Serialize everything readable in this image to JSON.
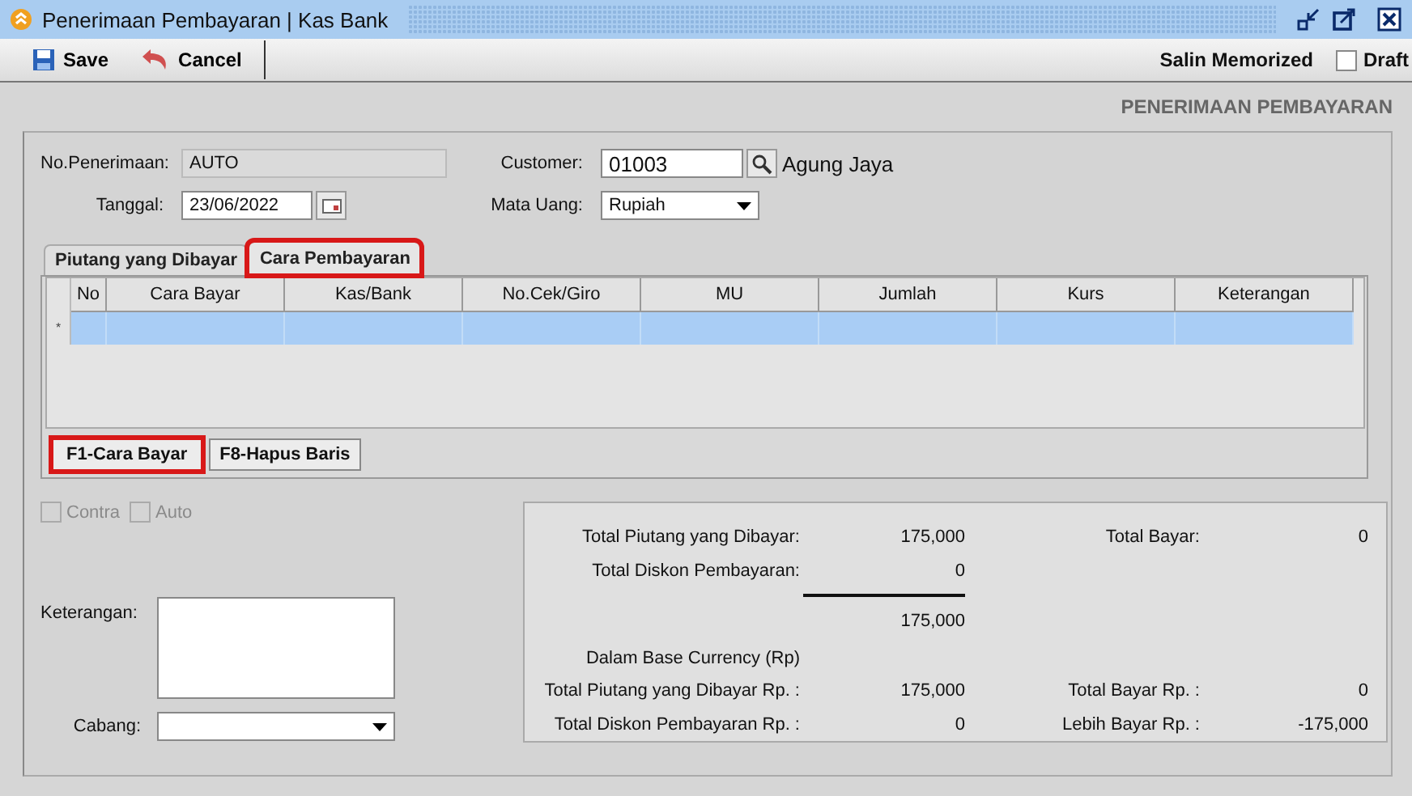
{
  "window": {
    "title": "Penerimaan Pembayaran | Kas Bank"
  },
  "toolbar": {
    "buttons": [
      {
        "label": "Save",
        "kind": "save"
      },
      {
        "label": "Cancel",
        "kind": "cancel"
      }
    ],
    "memorized": "Salin Memorized",
    "draft": {
      "label": "Draft",
      "checked": false
    }
  },
  "heading": "PENERIMAAN PEMBAYARAN",
  "form": {
    "number": {
      "label": "No.Penerimaan:",
      "value": "AUTO"
    },
    "date": {
      "label": "Tanggal:",
      "value": "23/06/2022"
    },
    "customer": {
      "label": "Customer:",
      "value": "01003",
      "name": "Agung Jaya"
    },
    "currency": {
      "label": "Mata Uang:",
      "value": "Rupiah"
    }
  },
  "tabs": [
    {
      "label": "Piutang yang Dibayar",
      "selected": false,
      "highlighted": false
    },
    {
      "label": "Cara Pembayaran",
      "selected": true,
      "highlighted": true
    }
  ],
  "table": {
    "columns": [
      "No",
      "Cara Bayar",
      "Kas/Bank",
      "No.Cek/Giro",
      "MU",
      "Jumlah",
      "Kurs",
      "Keterangan"
    ],
    "row_marker": "*"
  },
  "actions": [
    {
      "label": "F1-Cara Bayar",
      "highlighted": true
    },
    {
      "label": "F8-Hapus Baris",
      "highlighted": false
    }
  ],
  "options": [
    {
      "label": "Contra",
      "checked": false,
      "disabled": true
    },
    {
      "label": "Auto",
      "checked": false,
      "disabled": true
    }
  ],
  "notes": {
    "label": "Keterangan:"
  },
  "branch": {
    "label": "Cabang:"
  },
  "summary": [
    {
      "kind": "pair",
      "label": "Total Piutang yang Dibayar:",
      "value": "175,000",
      "label2": "Total Bayar:",
      "value2": "0"
    },
    {
      "kind": "pair",
      "label": "Total Diskon Pembayaran:",
      "value": "0"
    },
    {
      "kind": "rule"
    },
    {
      "kind": "pair",
      "value": "175,000"
    },
    {
      "kind": "heading",
      "label": "Dalam Base Currency (Rp)"
    },
    {
      "kind": "pair",
      "label": "Total Piutang yang Dibayar Rp. :",
      "value": "175,000",
      "label2": "Total Bayar Rp. :",
      "value2": "0"
    },
    {
      "kind": "pair",
      "label": "Total Diskon Pembayaran Rp. :",
      "value": "0",
      "label2": "Lebih Bayar Rp. :",
      "value2": "-175,000"
    }
  ]
}
